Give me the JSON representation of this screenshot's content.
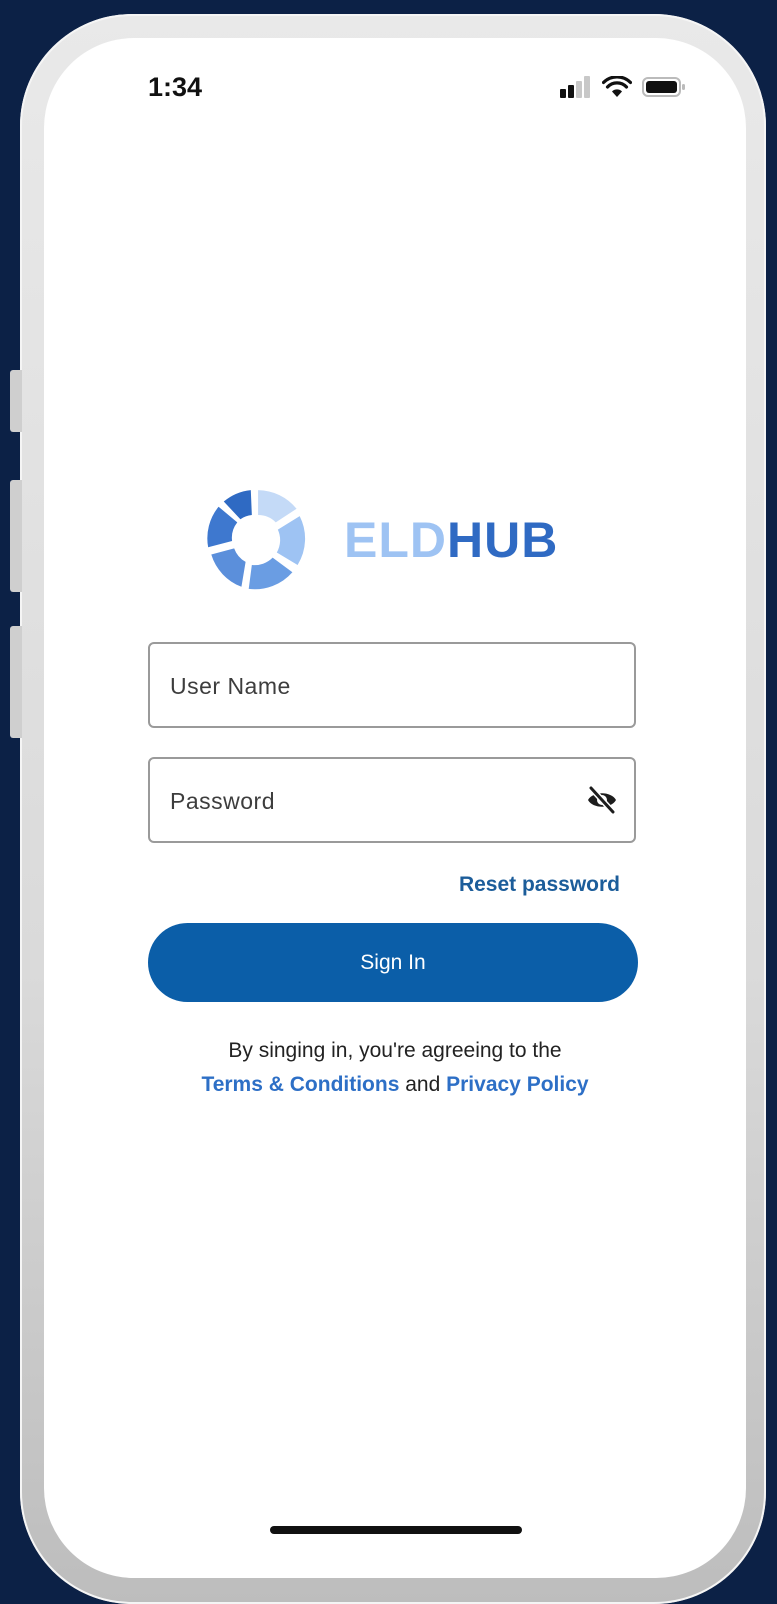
{
  "status_bar": {
    "time": "1:34",
    "signal_icon": "cellular-signal-icon",
    "wifi_icon": "wifi-icon",
    "battery_icon": "battery-icon"
  },
  "logo": {
    "icon": "eldhub-ring-logo",
    "text_part1": "ELD",
    "text_part2": "HUB",
    "colors": {
      "light": "#9ec3f3",
      "dark": "#2f6ac3"
    }
  },
  "form": {
    "username_placeholder": "User Name",
    "password_placeholder": "Password",
    "password_toggle_icon": "eye-off-icon",
    "reset_label": "Reset password",
    "signin_label": "Sign In"
  },
  "legal": {
    "line1": "By singing in, you're agreeing to the",
    "terms_label": "Terms & Conditions",
    "and_label": "and",
    "privacy_label": "Privacy Policy"
  },
  "colors": {
    "background": "#0c2146",
    "primary_button": "#0b5ea8",
    "link": "#2d6fc6"
  }
}
